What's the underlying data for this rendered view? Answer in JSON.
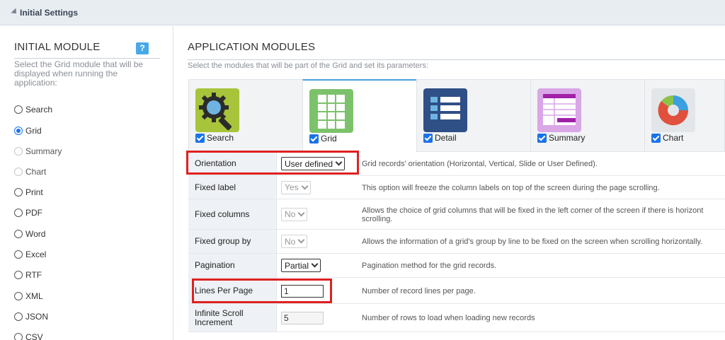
{
  "header": {
    "title": "Initial Settings"
  },
  "left": {
    "heading": "INITIAL MODULE",
    "help": "?",
    "description": "Select the Grid module that will be displayed when running the application:",
    "options": [
      {
        "label": "Search",
        "state": "enabled"
      },
      {
        "label": "Grid",
        "state": "checked"
      },
      {
        "label": "Summary",
        "state": "disabled"
      },
      {
        "label": "Chart",
        "state": "disabled"
      },
      {
        "label": "Print",
        "state": "enabled"
      },
      {
        "label": "PDF",
        "state": "enabled"
      },
      {
        "label": "Word",
        "state": "enabled"
      },
      {
        "label": "Excel",
        "state": "enabled"
      },
      {
        "label": "RTF",
        "state": "enabled"
      },
      {
        "label": "XML",
        "state": "enabled"
      },
      {
        "label": "JSON",
        "state": "enabled"
      },
      {
        "label": "CSV",
        "state": "enabled"
      }
    ]
  },
  "right": {
    "heading": "APPLICATION MODULES",
    "description": "Select the modules that will be part of the Grid and set its parameters:",
    "tabs": [
      {
        "label": "Search",
        "icon": "search-module-icon",
        "checked": true
      },
      {
        "label": "Grid",
        "icon": "grid-module-icon",
        "checked": true
      },
      {
        "label": "Detail",
        "icon": "detail-module-icon",
        "checked": true
      },
      {
        "label": "Summary",
        "icon": "summary-module-icon",
        "checked": true
      },
      {
        "label": "Chart",
        "icon": "chart-module-icon",
        "checked": true
      }
    ],
    "settings": [
      {
        "label": "Orientation",
        "value": "User defined",
        "type": "select",
        "help": "Grid records' orientation (Horizontal, Vertical, Slide or User Defined)."
      },
      {
        "label": "Fixed label",
        "value": "Yes",
        "type": "select-disabled",
        "help": "This option will freeze the column labels on top of the screen during the page scrolling."
      },
      {
        "label": "Fixed columns",
        "value": "No",
        "type": "select-disabled",
        "help": "Allows the choice of grid columns that will be fixed in the left corner of the screen if there is horizont scrolling."
      },
      {
        "label": "Fixed group by",
        "value": "No",
        "type": "select-disabled",
        "help": "Allows the information of a grid's group by line to be fixed on the screen when scrolling horizontally."
      },
      {
        "label": "Pagination",
        "value": "Partial",
        "type": "select",
        "help": "Pagination method for the grid records."
      },
      {
        "label": "Lines Per Page",
        "value": "1",
        "type": "text",
        "help": "Number of record lines per page."
      },
      {
        "label": "Infinite Scroll Increment",
        "value": "5",
        "type": "text-disabled",
        "help": "Number of rows to load when loading new records"
      }
    ]
  },
  "colors": {
    "accent": "#1a73e8",
    "highlight": "#e02020",
    "help_badge": "#48a9e6"
  }
}
